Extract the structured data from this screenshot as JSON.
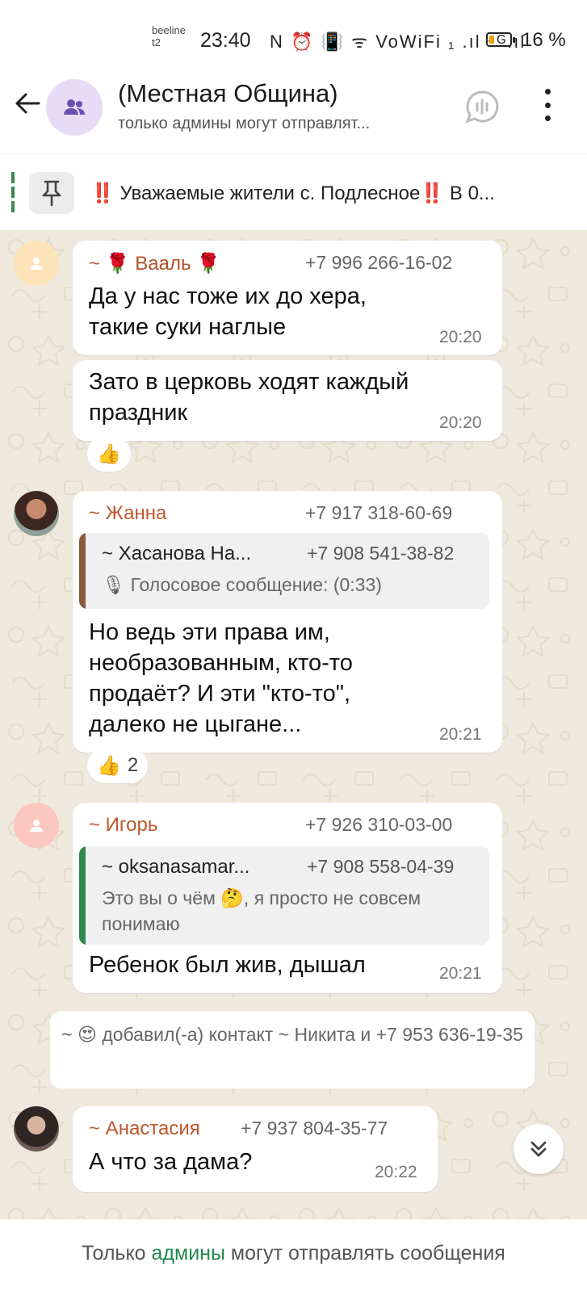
{
  "status_bar": {
    "carrier_top": "beeline",
    "carrier_bottom": "t2",
    "time": "23:40",
    "icons_text": "N ⏰ 📳 ᯤ VoWiFi ₁ .ıl ⁴ᴳ.ıl",
    "battery_percent": "16 %",
    "battery_level": 0.16
  },
  "header": {
    "title": "(Местная Община)",
    "subtitle": "только админы могут отправлят...",
    "back_icon": "arrow-left-icon",
    "avatar_icon": "group-icon",
    "voice_icon": "voice-chat-icon",
    "menu_icon": "more-vertical-icon"
  },
  "pinned": {
    "icon": "pin-icon",
    "prefix": "‼️",
    "text": " Уважаемые жители с. Подлесное",
    "suffix": "‼️",
    "tail": " В 0..."
  },
  "messages": {
    "m1": {
      "sender": "~ 🌹 Вааль 🌹",
      "sender_color": "#b5502a",
      "phone": "+7 996 266-16-02",
      "text": "Да у нас тоже их до хера, такие суки наглые",
      "time": "20:20"
    },
    "m2": {
      "text": "Зато в церковь ходят каждый праздник",
      "time": "20:20",
      "reaction": "👍"
    },
    "m3": {
      "sender": "~ Жанна",
      "sender_color": "#c0562c",
      "phone": "+7 917 318-60-69",
      "quote_name": "~ Хасанова На...",
      "quote_phone": "+7 908 541-38-82",
      "quote_text": "🎙 Голосовое сообщение: (0:33)",
      "quote_bar_color": "#8a5a3a",
      "text": "Но ведь эти права им, необразованным, кто-то продаёт? И эти \"кто-то\", далеко не цыгане...",
      "time": "20:21",
      "reaction": "👍",
      "reaction_count": "2"
    },
    "m4": {
      "sender": "~ Игорь",
      "sender_color": "#c0562c",
      "phone": "+7 926 310-03-00",
      "quote_name": "~ oksanasamar...",
      "quote_phone": "+7 908 558-04-39",
      "quote_text": "Это вы о чём 🤔, я просто не совсем понимаю",
      "quote_bar_color": "#2f8a4e",
      "text": "Ребенок был жив, дышал",
      "time": "20:21"
    },
    "system": {
      "text": "~ 😍 добавил(-а) контакт ~ Никита и +7 953 636-19-35"
    },
    "m5": {
      "sender": "~ Анастасия",
      "sender_color": "#c0562c",
      "phone": "+7 937 804-35-77",
      "text": "А что за дама?",
      "time": "20:22"
    }
  },
  "scroll_button_icon": "double-chevron-down-icon",
  "footer": {
    "before": "Только ",
    "link": "админы",
    "after": " могут отправлять сообщения"
  }
}
